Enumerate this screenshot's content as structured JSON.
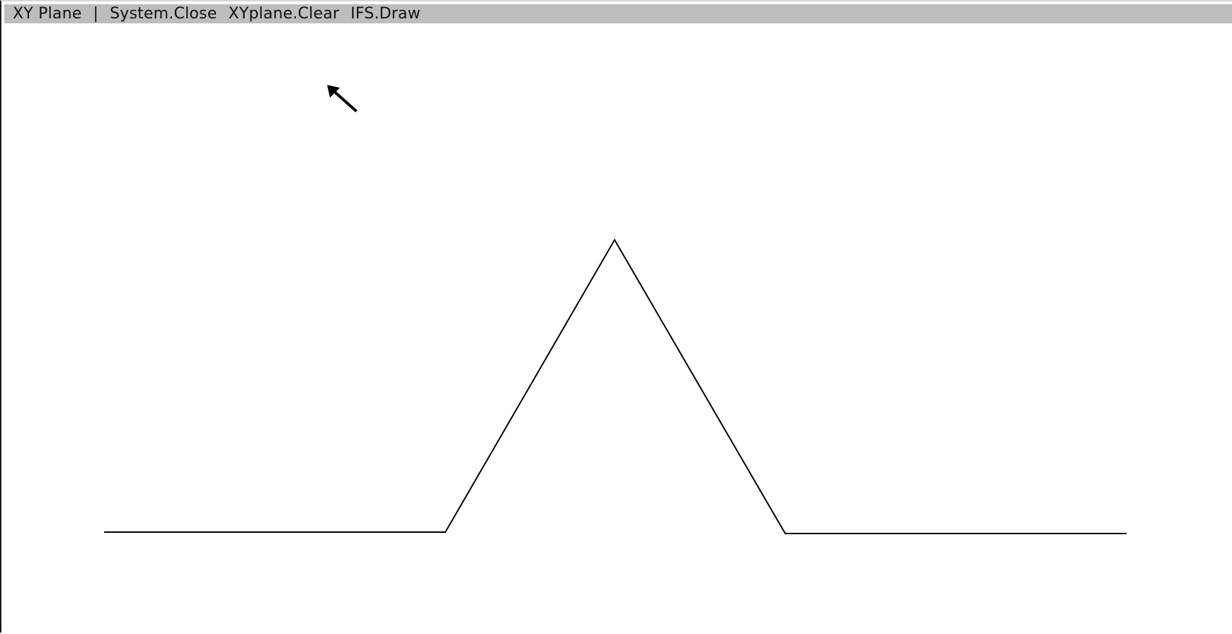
{
  "window": {
    "title": "XY Plane",
    "separator": "|",
    "commands": [
      {
        "label": "System.Close"
      },
      {
        "label": "XYplane.Clear"
      },
      {
        "label": "IFS.Draw"
      }
    ]
  },
  "colors": {
    "title_bar_bg": "#bdbdbd",
    "canvas_bg": "#ffffff",
    "stroke": "#000000"
  },
  "canvas": {
    "content": "koch-curve-iteration-1"
  },
  "pointer": {
    "icon": "arrow-cursor-icon"
  }
}
